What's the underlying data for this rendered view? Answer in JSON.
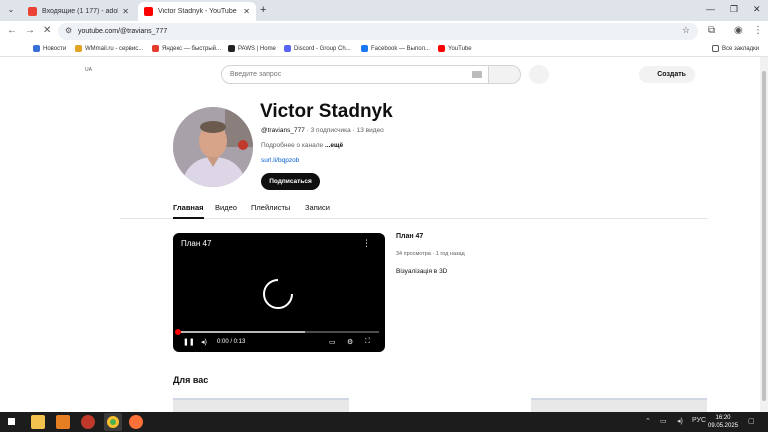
{
  "browser": {
    "tabs": [
      {
        "title": "Входящие (1 177) - adobinivan@...",
        "active": false
      },
      {
        "title": "Victor Stadnyk - YouTube",
        "active": true
      }
    ],
    "url": "youtube.com/@travians_777",
    "bookmarks": [
      {
        "label": "Новости",
        "color": "#3b6fd8"
      },
      {
        "label": "WMmail.ru - сервис...",
        "color": "#e3a324"
      },
      {
        "label": "Яндекс — быстрый...",
        "color": "#e33b2e"
      },
      {
        "label": "PAWS | Home",
        "color": "#222222"
      },
      {
        "label": "Discord - Group Ch...",
        "color": "#5865f2"
      },
      {
        "label": "Facebook — Выпол...",
        "color": "#1877f2"
      },
      {
        "label": "YouTube",
        "color": "#ff0000"
      }
    ],
    "all_bookmarks_label": "Все закладки"
  },
  "youtube": {
    "country_code": "UA",
    "search_placeholder": "Введите запрос",
    "create_label": "Создать",
    "channel": {
      "name": "Victor Stadnyk",
      "handle": "@travians_777",
      "subscribers": "3 подписчика",
      "videos": "13 видео",
      "description": "Подробнее о канале",
      "more_label": "...ещё",
      "link": "surl.li/bqpzob",
      "subscribe_label": "Подписаться"
    },
    "tabs": [
      "Главная",
      "Видео",
      "Плейлисты",
      "Записи"
    ],
    "featured": {
      "title": "План 47",
      "time": "0:00 / 0:13",
      "progress_buffered": 0.63,
      "views": "34 просмотра",
      "age": "1 год назад",
      "description": "Візуалізація в 3D"
    },
    "section_title": "Для вас"
  },
  "taskbar": {
    "language": "РУС",
    "time": "16:20",
    "date": "09.05.2025"
  }
}
